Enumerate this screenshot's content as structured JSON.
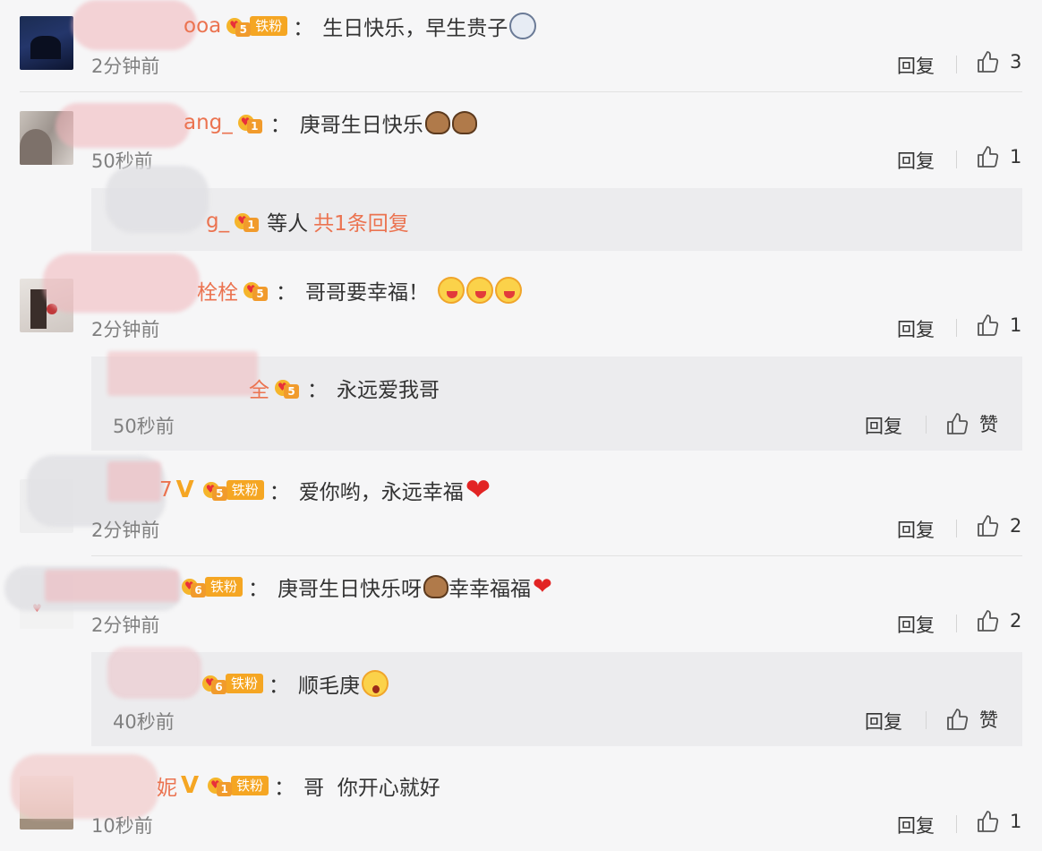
{
  "comments": [
    {
      "user": "ooa",
      "level": "5",
      "tiefen": "铁粉",
      "text": "生日快乐，早生贵子",
      "emojis": [
        "ghost-emoji"
      ],
      "time": "2分钟前",
      "reply": "回复",
      "likes": "3"
    },
    {
      "user": "ang_",
      "level": "1",
      "text": "庚哥生日快乐",
      "emojis": [
        "cake-emoji",
        "cake-emoji"
      ],
      "time": "50秒前",
      "reply": "回复",
      "likes": "1",
      "subreply_summary": {
        "user": "g_",
        "level": "1",
        "label": "等人",
        "count_text": "共1条回复"
      }
    },
    {
      "user": "栓栓",
      "level": "5",
      "text": "哥哥要幸福！",
      "emojis": [
        "cry-emoji",
        "cry-emoji",
        "cry-emoji"
      ],
      "time": "2分钟前",
      "reply": "回复",
      "likes": "1",
      "subreply": {
        "user": "全",
        "level": "5",
        "text": "永远爱我哥",
        "time": "50秒前",
        "reply": "回复",
        "likes": "赞"
      }
    },
    {
      "user": "7",
      "level": "5",
      "verified": "V",
      "tiefen": "铁粉",
      "text": "爱你哟，永远幸福",
      "emojis": [
        "heart-emoji"
      ],
      "time": "2分钟前",
      "reply": "回复",
      "likes": "2"
    },
    {
      "user": "",
      "level": "6",
      "tiefen": "铁粉",
      "text": "庚哥生日快乐呀",
      "text2": "幸幸福福",
      "emojis": [
        "cake-emoji"
      ],
      "emojis2": [
        "heart-emoji"
      ],
      "time": "2分钟前",
      "reply": "回复",
      "likes": "2",
      "subreply": {
        "user": "",
        "level": "6",
        "tiefen": "铁粉",
        "text": "顺毛庚",
        "time": "40秒前",
        "reply": "回复",
        "likes": "赞"
      }
    },
    {
      "user": "妮",
      "level": "1",
      "verified": "V",
      "tiefen": "铁粉",
      "text": "哥  你开心就好",
      "time": "10秒前",
      "reply": "回复",
      "likes": "1"
    }
  ],
  "colors": {
    "username": "#eb7350",
    "badge": "#f5a623",
    "time": "#808080",
    "background": "#f6f6f7",
    "subreply_bg": "#ececee"
  }
}
